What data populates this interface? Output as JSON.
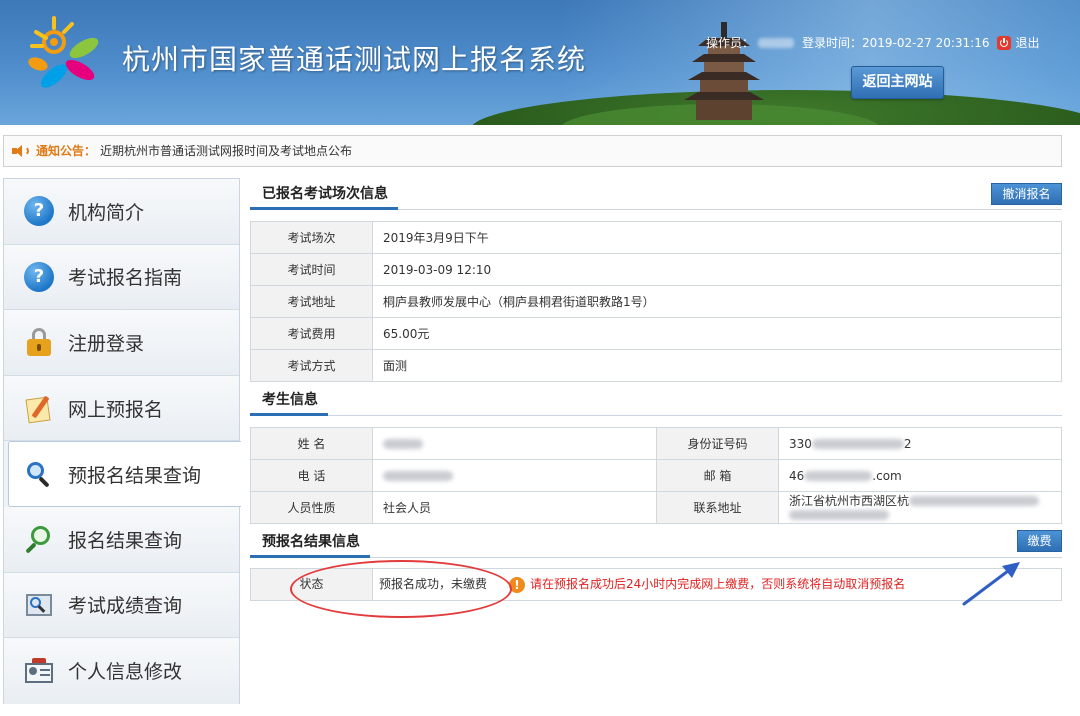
{
  "header": {
    "title": "杭州市国家普通话测试网上报名系统",
    "operator_label": "操作员：",
    "login_time_label": "登录时间：",
    "login_time": "2019-02-27 20:31:16",
    "logout_label": "退出",
    "back_button": "返回主网站"
  },
  "notice": {
    "label": "通知公告：",
    "text": "近期杭州市普通话测试网报时间及考试地点公布"
  },
  "sidebar": {
    "items": [
      {
        "label": "机构简介",
        "icon": "question-icon"
      },
      {
        "label": "考试报名指南",
        "icon": "question-icon"
      },
      {
        "label": "注册登录",
        "icon": "lock-icon"
      },
      {
        "label": "网上预报名",
        "icon": "notepad-icon"
      },
      {
        "label": "预报名结果查询",
        "icon": "search-icon",
        "active": true
      },
      {
        "label": "报名结果查询",
        "icon": "find-icon"
      },
      {
        "label": "考试成绩查询",
        "icon": "score-search-icon"
      },
      {
        "label": "个人信息修改",
        "icon": "id-card-icon"
      }
    ]
  },
  "exam_section": {
    "title": "已报名考试场次信息",
    "cancel_button": "撤消报名",
    "rows": [
      {
        "key": "考试场次",
        "value": "2019年3月9日下午"
      },
      {
        "key": "考试时间",
        "value": "2019-03-09 12:10"
      },
      {
        "key": "考试地址",
        "value": "桐庐县教师发展中心（桐庐县桐君街道职教路1号）"
      },
      {
        "key": "考试费用",
        "value": "65.00元"
      },
      {
        "key": "考试方式",
        "value": "面测"
      }
    ]
  },
  "candidate_section": {
    "title": "考生信息",
    "name_label": "姓 名",
    "id_label": "身份证号码",
    "id_prefix": "330",
    "id_suffix": "2",
    "phone_label": "电 话",
    "email_label": "邮 箱",
    "email_prefix": "46",
    "email_suffix": ".com",
    "type_label": "人员性质",
    "type_value": "社会人员",
    "address_label": "联系地址",
    "address_value": "浙江省杭州市西湖区杭"
  },
  "result_section": {
    "title": "预报名结果信息",
    "pay_button": "缴费",
    "status_label": "状态",
    "status_value": "预报名成功，未缴费",
    "warning_icon": "!",
    "warning_text": "请在预报名成功后24小时内完成网上缴费，否则系统将自动取消预报名"
  },
  "colors": {
    "accent": "#2d6fb5",
    "warning": "#e02020",
    "notice": "#e07b16",
    "annotation": "#e23b3b"
  }
}
